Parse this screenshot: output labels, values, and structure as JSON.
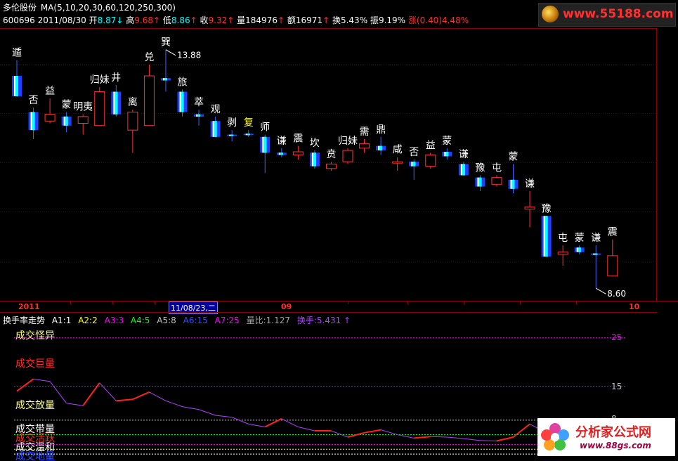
{
  "header": {
    "stock_name": "多伦股份",
    "ma_label": "MA(5,10,20,30,60,120,250,300)",
    "code": "600696",
    "date": "2011/08/30",
    "open_label": "开",
    "open_value": "8.87",
    "open_arrow": "↓",
    "high_label": "高",
    "high_value": "9.68",
    "high_arrow": "↑",
    "low_label": "低",
    "low_value": "8.86",
    "low_arrow": "↑",
    "close_label": "收",
    "close_value": "9.32",
    "close_arrow": "↑",
    "volume_label": "量",
    "volume_value": "184976",
    "volume_arrow": "↑",
    "amount_label": "额",
    "amount_value": "16971",
    "amount_arrow": "↑",
    "turnover_label": "换",
    "turnover_value": "5.43%",
    "amplitude_label": "振",
    "amplitude_value": "9.19%",
    "change_label": "涨",
    "change_value": "(0.40)",
    "change_pct": "4.48%"
  },
  "watermark_top": "www.55188.com",
  "watermark_bottom": {
    "title": "分析家公式网",
    "url": "www.88gs.com"
  },
  "main_chart": {
    "high_marker": "13.88",
    "low_marker": "8.60",
    "candles": [
      {
        "o": 12.85,
        "c": 13.3,
        "h": 13.65,
        "l": 12.85,
        "up": false,
        "label": "遁"
      },
      {
        "o": 12.5,
        "c": 12.1,
        "h": 12.6,
        "l": 11.9,
        "up": false,
        "label": "否"
      },
      {
        "o": 12.3,
        "c": 12.45,
        "h": 12.8,
        "l": 12.25,
        "up": true,
        "label": "益"
      },
      {
        "o": 12.4,
        "c": 12.2,
        "h": 12.5,
        "l": 12.05,
        "up": false,
        "label": "蒙"
      },
      {
        "o": 12.25,
        "c": 12.4,
        "h": 12.45,
        "l": 12.0,
        "up": true,
        "label": "明夷"
      },
      {
        "o": 12.2,
        "c": 12.95,
        "h": 13.05,
        "l": 12.2,
        "up": true,
        "label": "归妹"
      },
      {
        "o": 12.95,
        "c": 12.45,
        "h": 13.1,
        "l": 12.4,
        "up": false,
        "label": "井"
      },
      {
        "o": 12.1,
        "c": 12.5,
        "h": 12.55,
        "l": 11.6,
        "up": true,
        "label": "离"
      },
      {
        "o": 12.2,
        "c": 13.3,
        "h": 13.55,
        "l": 12.2,
        "up": true,
        "label": "兑"
      },
      {
        "o": 13.2,
        "c": 13.25,
        "h": 13.88,
        "l": 12.95,
        "up": false,
        "label": "巽"
      },
      {
        "o": 12.95,
        "c": 12.5,
        "h": 13.0,
        "l": 12.4,
        "up": false,
        "label": "旅"
      },
      {
        "o": 12.45,
        "c": 12.4,
        "h": 12.55,
        "l": 12.2,
        "up": false,
        "label": "萃"
      },
      {
        "o": 12.3,
        "c": 11.95,
        "h": 12.4,
        "l": 11.95,
        "up": false,
        "label": "观"
      },
      {
        "o": 12.0,
        "c": 12.0,
        "h": 12.1,
        "l": 11.85,
        "up": false,
        "label": "剥"
      },
      {
        "o": 12.02,
        "c": 12.0,
        "h": 12.1,
        "l": 11.95,
        "up": false,
        "label": "复"
      },
      {
        "o": 11.95,
        "c": 11.6,
        "h": 12.0,
        "l": 11.15,
        "up": false,
        "label": "师"
      },
      {
        "o": 11.6,
        "c": 11.55,
        "h": 11.7,
        "l": 11.5,
        "up": false,
        "label": "谦"
      },
      {
        "o": 11.55,
        "c": 11.62,
        "h": 11.75,
        "l": 11.45,
        "up": true,
        "label": "震"
      },
      {
        "o": 11.6,
        "c": 11.3,
        "h": 11.65,
        "l": 11.25,
        "up": false,
        "label": "坎"
      },
      {
        "o": 11.25,
        "c": 11.35,
        "h": 11.4,
        "l": 11.2,
        "up": true,
        "label": "贲"
      },
      {
        "o": 11.4,
        "c": 11.65,
        "h": 11.7,
        "l": 11.35,
        "up": true,
        "label": "归妹"
      },
      {
        "o": 11.7,
        "c": 11.8,
        "h": 11.9,
        "l": 11.6,
        "up": true,
        "label": "需"
      },
      {
        "o": 11.75,
        "c": 11.65,
        "h": 11.95,
        "l": 11.55,
        "up": false,
        "label": "鼎"
      },
      {
        "o": 11.4,
        "c": 11.4,
        "h": 11.5,
        "l": 11.2,
        "up": true,
        "label": "咸"
      },
      {
        "o": 11.4,
        "c": 11.3,
        "h": 11.45,
        "l": 11.0,
        "up": false,
        "label": "否"
      },
      {
        "o": 11.3,
        "c": 11.55,
        "h": 11.6,
        "l": 11.25,
        "up": true,
        "label": "益"
      },
      {
        "o": 11.62,
        "c": 11.52,
        "h": 11.7,
        "l": 11.45,
        "up": false,
        "label": "蒙"
      },
      {
        "o": 11.35,
        "c": 11.1,
        "h": 11.4,
        "l": 11.1,
        "up": false,
        "label": "谦"
      },
      {
        "o": 11.05,
        "c": 10.85,
        "h": 11.1,
        "l": 10.75,
        "up": false,
        "label": "豫"
      },
      {
        "o": 10.9,
        "c": 11.05,
        "h": 11.1,
        "l": 10.85,
        "up": true,
        "label": "屯"
      },
      {
        "o": 11.0,
        "c": 10.8,
        "h": 11.35,
        "l": 10.7,
        "up": false,
        "label": "蒙"
      },
      {
        "o": 10.35,
        "c": 10.4,
        "h": 10.75,
        "l": 9.95,
        "up": true,
        "label": "谦"
      },
      {
        "o": 10.2,
        "c": 9.3,
        "h": 10.2,
        "l": 9.3,
        "up": false,
        "label": "豫"
      },
      {
        "o": 9.35,
        "c": 9.4,
        "h": 9.55,
        "l": 9.1,
        "up": true,
        "label": "屯"
      },
      {
        "o": 9.5,
        "c": 9.4,
        "h": 9.55,
        "l": 9.35,
        "up": false,
        "label": "蒙"
      },
      {
        "o": 9.37,
        "c": 9.35,
        "h": 9.55,
        "l": 8.6,
        "up": false,
        "label": "谦"
      },
      {
        "o": 8.87,
        "c": 9.32,
        "h": 9.68,
        "l": 8.86,
        "up": true,
        "label": "震"
      }
    ],
    "price_range": [
      8.4,
      14.0
    ]
  },
  "date_axis": {
    "labels": [
      "2011",
      "11/08/23,二",
      "09",
      "10"
    ]
  },
  "sub_chart": {
    "title": "换手率走势",
    "legend": [
      {
        "text": "A1:1",
        "color": "#ffffff"
      },
      {
        "text": "A2:2",
        "color": "#ffff00"
      },
      {
        "text": "A3:3",
        "color": "#ff00ff"
      },
      {
        "text": "A4:5",
        "color": "#00ff00"
      },
      {
        "text": "A5:8",
        "color": "#c0c0c0"
      },
      {
        "text": "A6:15",
        "color": "#3050ff"
      },
      {
        "text": "A7:25",
        "color": "#ff00ff"
      },
      {
        "text": "量比:1.127",
        "color": "#a0a0a0"
      },
      {
        "text": "换手:5.431 ↑",
        "color": "#b040ff"
      }
    ],
    "zones": [
      {
        "text": "成交怪异",
        "color": "#ffff80"
      },
      {
        "text": "成交巨量",
        "color": "#ff3030"
      },
      {
        "text": "成交放量",
        "color": "#ffff80"
      },
      {
        "text": "成交带量",
        "color": "#ffffff"
      },
      {
        "text": "成交活跃",
        "color": "#ff3030"
      },
      {
        "text": "成交温和",
        "color": "#ffffff"
      },
      {
        "text": "成交地量",
        "color": "#3050ff"
      }
    ],
    "axis_labels": [
      "25",
      "15",
      "8"
    ],
    "turnover_values": [
      14.0,
      16.5,
      16.0,
      11.5,
      11.0,
      15.7,
      12.0,
      12.3,
      13.8,
      12.0,
      10.8,
      10.2,
      9.0,
      8.6,
      7.2,
      6.6,
      8.3,
      6.6,
      5.8,
      5.8,
      4.5,
      5.4,
      6.0,
      5.0,
      4.3,
      4.6,
      4.5,
      4.2,
      3.8,
      3.7,
      4.5,
      7.2,
      5.4,
      5.6,
      5.3,
      5.0,
      6.0
    ]
  },
  "colors": {
    "up": "#ff3030",
    "down": "#00ffff",
    "grid": "#8b0000",
    "label": "#ffffff"
  }
}
